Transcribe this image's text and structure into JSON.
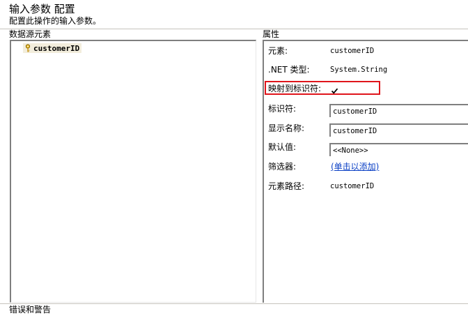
{
  "header": {
    "title": "输入参数 配置",
    "subtitle": "配置此操作的输入参数。"
  },
  "left_panel": {
    "heading": "数据源元素",
    "tree": [
      {
        "label": "customerID",
        "icon": "key-icon"
      }
    ]
  },
  "right_panel": {
    "heading": "属性",
    "element": {
      "label": "元素:",
      "value": "customerID"
    },
    "net_type": {
      "label": ".NET 类型:",
      "value": "System.String"
    },
    "map_to_identifier": {
      "label": "映射到标识符:",
      "checked": true
    },
    "identifier": {
      "label": "标识符:",
      "value": "customerID"
    },
    "display_name": {
      "label": "显示名称:",
      "value": "customerID"
    },
    "default_value": {
      "label": "默认值:",
      "value": "<<None>>"
    },
    "filters": {
      "label": "筛选器:",
      "link": "(单击以添加)"
    },
    "element_path": {
      "label": "元素路径:",
      "value": "customerID"
    }
  },
  "footer": {
    "errors_heading": "错误和警告"
  },
  "colors": {
    "highlight": "#e0151b",
    "link": "#0b40c5",
    "selection": "#f2eddc"
  }
}
